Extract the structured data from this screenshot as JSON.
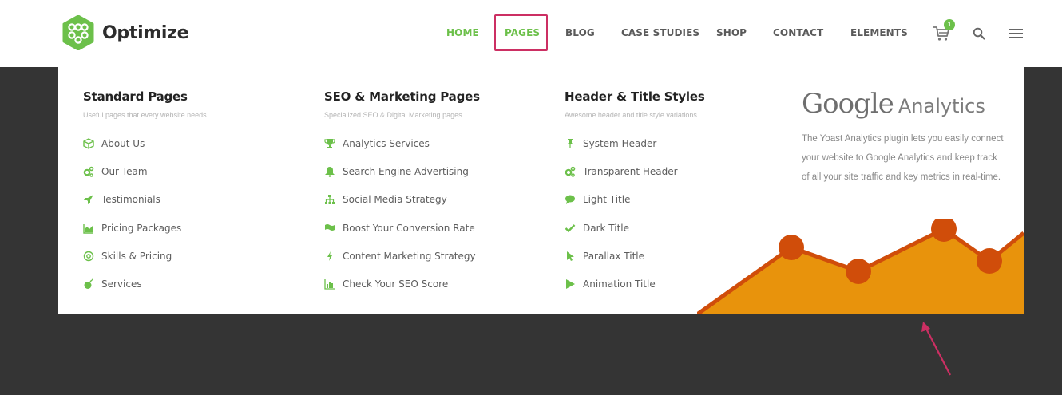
{
  "brand": {
    "name": "Optimize",
    "accent": "#6cc04a",
    "highlight": "#cc2f63"
  },
  "nav": {
    "items": [
      {
        "label": "HOME",
        "active": true
      },
      {
        "label": "PAGES",
        "active": true
      },
      {
        "label": "BLOG"
      },
      {
        "label": "CASE STUDIES"
      },
      {
        "label": "SHOP"
      },
      {
        "label": "CONTACT"
      },
      {
        "label": "ELEMENTS"
      }
    ],
    "cart_count": "1",
    "icons": [
      "cart-icon",
      "search-icon",
      "hamburger-menu-icon"
    ]
  },
  "mega_menu": {
    "columns": [
      {
        "title": "Standard Pages",
        "subtitle": "Useful pages that every website needs",
        "links": [
          {
            "label": "About Us",
            "icon": "cube-icon"
          },
          {
            "label": "Our Team",
            "icon": "cogs-icon"
          },
          {
            "label": "Testimonials",
            "icon": "rocket-icon"
          },
          {
            "label": "Pricing Packages",
            "icon": "area-chart-icon"
          },
          {
            "label": "Skills & Pricing",
            "icon": "at-icon"
          },
          {
            "label": "Services",
            "icon": "bomb-icon"
          }
        ]
      },
      {
        "title": "SEO & Marketing Pages",
        "subtitle": "Specialized SEO & Digital Marketing pages",
        "links": [
          {
            "label": "Analytics Services",
            "icon": "trophy-icon"
          },
          {
            "label": "Search Engine Advertising",
            "icon": "bell-icon"
          },
          {
            "label": "Social Media Strategy",
            "icon": "sitemap-icon"
          },
          {
            "label": "Boost Your Conversion Rate",
            "icon": "flag-icon"
          },
          {
            "label": "Content Marketing Strategy",
            "icon": "bolt-icon"
          },
          {
            "label": "Check Your SEO Score",
            "icon": "bar-chart-icon"
          }
        ]
      },
      {
        "title": "Header & Title Styles",
        "subtitle": "Awesome header and title style variations",
        "links": [
          {
            "label": "System Header",
            "icon": "thumbtack-icon"
          },
          {
            "label": "Transparent Header",
            "icon": "cogs-icon"
          },
          {
            "label": "Light Title",
            "icon": "comment-icon"
          },
          {
            "label": "Dark Title",
            "icon": "check-icon"
          },
          {
            "label": "Parallax Title",
            "icon": "mouse-pointer-icon"
          },
          {
            "label": "Animation Title",
            "icon": "play-icon"
          }
        ]
      }
    ],
    "promo": {
      "logo_word": "Google",
      "logo_suffix": "Analytics",
      "description": "The Yoast Analytics plugin lets you easily connect your website to Google Analytics and keep track of all your site traffic and key metrics in real-time."
    }
  }
}
